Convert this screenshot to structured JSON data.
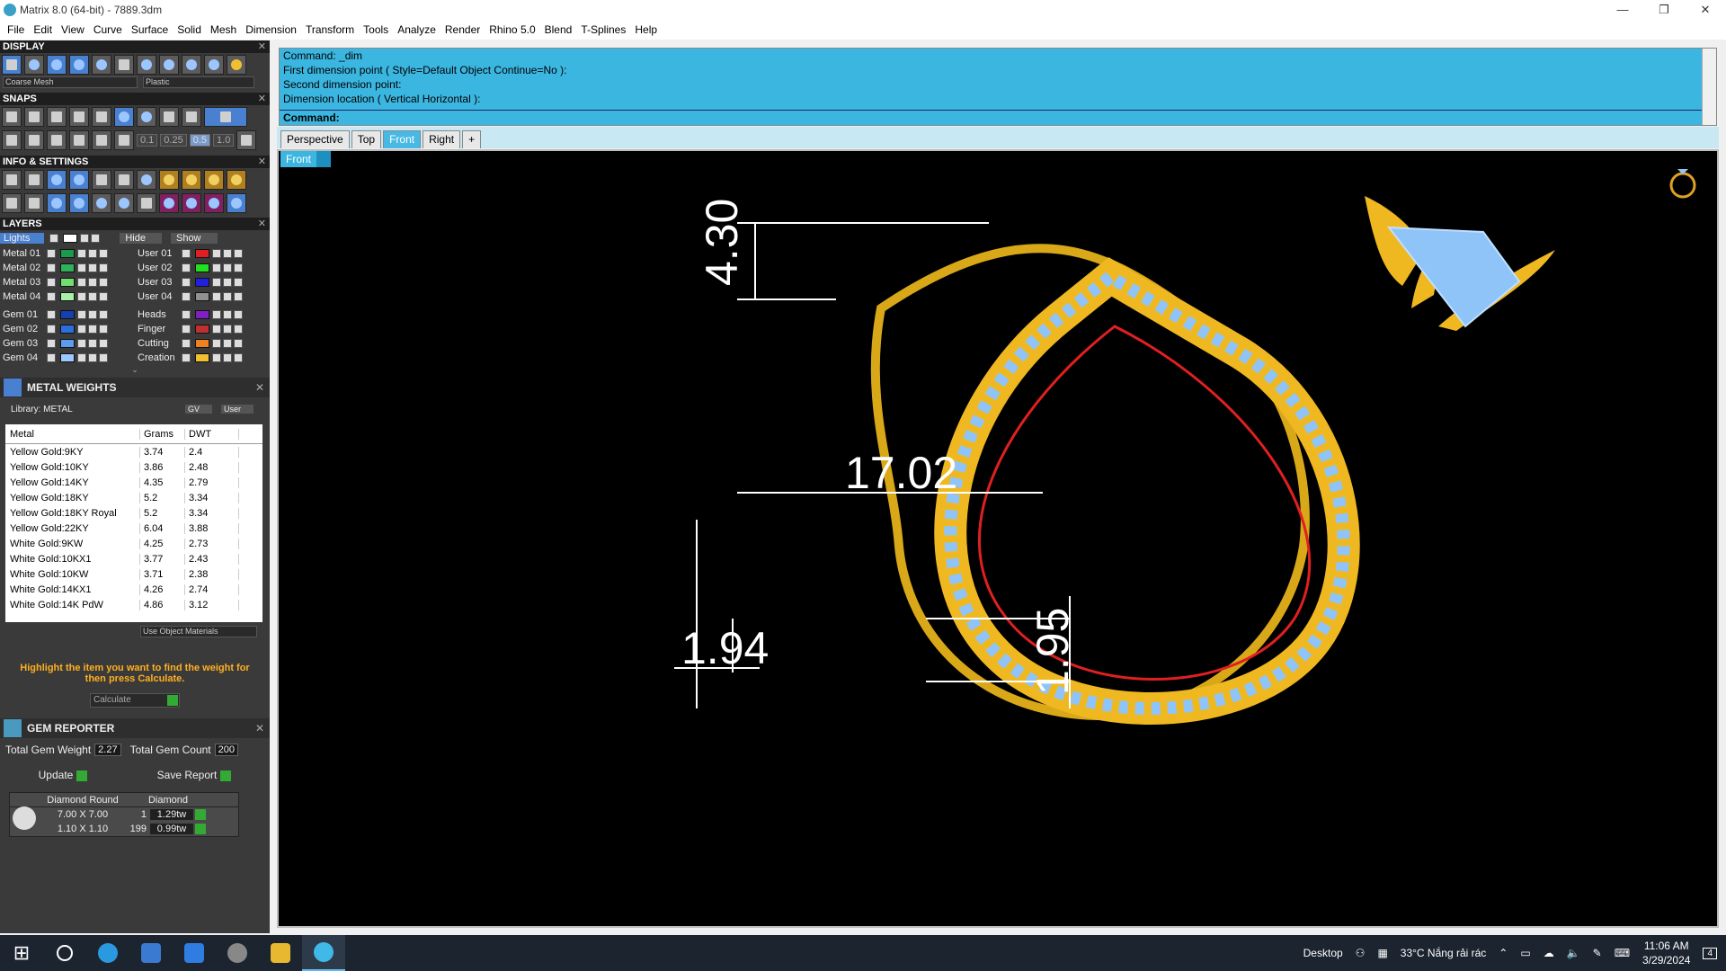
{
  "window": {
    "title": "Matrix 8.0 (64-bit) - 7889.3dm",
    "minimize": "—",
    "restore": "❐",
    "close": "✕"
  },
  "menu": [
    "File",
    "Edit",
    "View",
    "Curve",
    "Surface",
    "Solid",
    "Mesh",
    "Dimension",
    "Transform",
    "Tools",
    "Analyze",
    "Render",
    "Rhino 5.0",
    "Blend",
    "T-Splines",
    "Help"
  ],
  "display": {
    "header": "DISPLAY",
    "mesh_select": "Coarse Mesh",
    "material_select": "Plastic"
  },
  "snaps": {
    "header": "SNAPS",
    "values": [
      "0.1",
      "0.25",
      "0.5",
      "1.0"
    ]
  },
  "info": {
    "header": "INFO & SETTINGS"
  },
  "layers": {
    "header": "LAYERS",
    "lights_label": "Lights",
    "hide_label": "Hide",
    "show_label": "Show",
    "left": [
      {
        "name": "Metal 01",
        "color": "#1a9a4a"
      },
      {
        "name": "Metal 02",
        "color": "#2fb35a"
      },
      {
        "name": "Metal 03",
        "color": "#6fe06f"
      },
      {
        "name": "Metal 04",
        "color": "#a8f0a8"
      },
      {
        "name": "Gem 01",
        "color": "#1440b0"
      },
      {
        "name": "Gem 02",
        "color": "#2b6ee0"
      },
      {
        "name": "Gem 03",
        "color": "#5b9cf0"
      },
      {
        "name": "Gem 04",
        "color": "#9cc8ff"
      }
    ],
    "right": [
      {
        "name": "User 01",
        "color": "#e02020"
      },
      {
        "name": "User 02",
        "color": "#20e020"
      },
      {
        "name": "User 03",
        "color": "#2020e0"
      },
      {
        "name": "User 04",
        "color": "#909090"
      },
      {
        "name": "Heads",
        "color": "#8020c0"
      },
      {
        "name": "Finger",
        "color": "#c03030"
      },
      {
        "name": "Cutting",
        "color": "#f08020"
      },
      {
        "name": "Creation",
        "color": "#f0c030"
      }
    ]
  },
  "metal_weights": {
    "header": "METAL WEIGHTS",
    "library": "Library: METAL",
    "gv_label": "GV",
    "user_label": "User",
    "columns": [
      "Metal",
      "Grams",
      "DWT"
    ],
    "rows": [
      [
        "Yellow Gold:9KY",
        "3.74",
        "2.4"
      ],
      [
        "Yellow Gold:10KY",
        "3.86",
        "2.48"
      ],
      [
        "Yellow Gold:14KY",
        "4.35",
        "2.79"
      ],
      [
        "Yellow Gold:18KY",
        "5.2",
        "3.34"
      ],
      [
        "Yellow Gold:18KY Royal",
        "5.2",
        "3.34"
      ],
      [
        "Yellow Gold:22KY",
        "6.04",
        "3.88"
      ],
      [
        "White Gold:9KW",
        "4.25",
        "2.73"
      ],
      [
        "White Gold:10KX1",
        "3.77",
        "2.43"
      ],
      [
        "White Gold:10KW",
        "3.71",
        "2.38"
      ],
      [
        "White Gold:14KX1",
        "4.26",
        "2.74"
      ],
      [
        "White Gold:14K PdW",
        "4.86",
        "3.12"
      ]
    ],
    "use_object_materials": "Use Object Materials",
    "note": "Highlight the item you want to find the weight for then press Calculate.",
    "calculate_label": "Calculate"
  },
  "gem_reporter": {
    "header": "GEM REPORTER",
    "total_weight_label": "Total Gem Weight",
    "total_weight": "2.27",
    "total_count_label": "Total Gem Count",
    "total_count": "200",
    "update_label": "Update",
    "save_label": "Save Report",
    "table_head": [
      "Diamond Round",
      "Diamond"
    ],
    "rows": [
      [
        "7.00 X 7.00",
        "1",
        "1.29tw"
      ],
      [
        "1.10 X 1.10",
        "199",
        "0.99tw"
      ]
    ]
  },
  "command": {
    "lines": [
      "Command: _dim",
      "First dimension point ( Style=Default  Object  Continue=No ):",
      "Second dimension point:",
      "Dimension location ( Vertical  Horizontal ):"
    ],
    "prompt": "Command:"
  },
  "viewport_tabs": [
    "Perspective",
    "Top",
    "Front",
    "Right",
    "+"
  ],
  "active_tab": "Front",
  "viewport_label": "Front",
  "dimensions": {
    "top": "4.30",
    "inner": "17.02",
    "left": "1.94",
    "right": "1.95"
  },
  "taskbar": {
    "desktop_label": "Desktop",
    "weather": "33°C  Nắng rải rác",
    "time": "11:06 AM",
    "date": "3/29/2024",
    "notification_count": "4"
  },
  "colors": {
    "accent": "#3bb6e0",
    "gold": "#f0b820",
    "gem": "#8fc4f8",
    "red": "#e02020"
  }
}
